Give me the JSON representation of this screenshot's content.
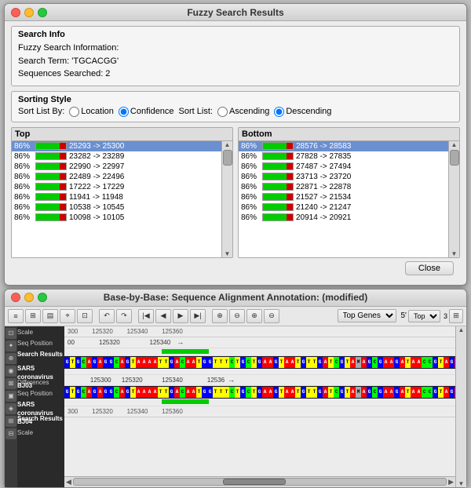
{
  "fuzzyWindow": {
    "title": "Fuzzy Search Results",
    "searchInfo": {
      "title": "Search Info",
      "label": "Fuzzy Search Information:",
      "searchTerm": "Search Term: 'TGCACGG'",
      "sequences": "Sequences Searched: 2"
    },
    "sortingStyle": {
      "title": "Sorting Style",
      "sortListByLabel": "Sort List By:",
      "options": [
        "Location",
        "Confidence"
      ],
      "selectedSortBy": "Confidence",
      "sortListLabel": "Sort List:",
      "sortOptions": [
        "Ascending",
        "Descending"
      ],
      "selectedSort": "Descending"
    },
    "topPanel": {
      "header": "Top",
      "rows": [
        {
          "pct": "86%",
          "range": "25293 -> 25300",
          "selected": true
        },
        {
          "pct": "86%",
          "range": "23282 -> 23289",
          "selected": false
        },
        {
          "pct": "86%",
          "range": "22990 -> 22997",
          "selected": false
        },
        {
          "pct": "86%",
          "range": "22489 -> 22496",
          "selected": false
        },
        {
          "pct": "86%",
          "range": "17222 -> 17229",
          "selected": false
        },
        {
          "pct": "86%",
          "range": "11941 -> 11948",
          "selected": false
        },
        {
          "pct": "86%",
          "range": "10538 -> 10545",
          "selected": false
        },
        {
          "pct": "86%",
          "range": "10098 -> 10105",
          "selected": false
        }
      ]
    },
    "bottomPanel": {
      "header": "Bottom",
      "rows": [
        {
          "pct": "86%",
          "range": "28576 -> 28583",
          "selected": true
        },
        {
          "pct": "86%",
          "range": "27828 -> 27835",
          "selected": false
        },
        {
          "pct": "86%",
          "range": "27487 -> 27494",
          "selected": false
        },
        {
          "pct": "86%",
          "range": "23713 -> 23720",
          "selected": false
        },
        {
          "pct": "86%",
          "range": "22871 -> 22878",
          "selected": false
        },
        {
          "pct": "86%",
          "range": "21527 -> 21534",
          "selected": false
        },
        {
          "pct": "86%",
          "range": "21240 -> 21247",
          "selected": false
        },
        {
          "pct": "86%",
          "range": "20914 -> 20921",
          "selected": false
        }
      ]
    },
    "closeButton": "Close"
  },
  "baseWindow": {
    "title": "Base-by-Base: Sequence Alignment Annotation:  (modified)",
    "toolbar": {
      "topGenesLabel": "Top Genes",
      "fivePrime": "5'",
      "topLabel": "Top"
    },
    "tracks": {
      "ruler1": {
        "positions": "300          125320          125340          125360"
      },
      "seqPosition1": {
        "label": "Seq Position",
        "value": "00              125320                    125340"
      },
      "searchResults1": {
        "label": "Search Results"
      },
      "sarsLabel1": "SARS coronavirus BJ03",
      "differences": {
        "label": "Differences"
      },
      "seqPosition2": {
        "label": "Seq Position"
      },
      "sarsLabel2": "SARS coronavirus BJ04",
      "searchResults2": {
        "label": "Search Results"
      },
      "ruler2": {
        "positions": "300          125320          125340          125360"
      },
      "sequence1": "GTGCAGAGGCAGTAAAAATTGACAATGGTTTCTGCTGAAGTAATGTTGATCGTAMAGCGAAGATAACCGTAGABA",
      "sequence2": "GTGCAGAGGCAGTAAAAATTGACAATGGTTTCTGCTGAAGTAATGTTGATCGTAMAGCGAAGATAACCGTAGABA"
    }
  }
}
